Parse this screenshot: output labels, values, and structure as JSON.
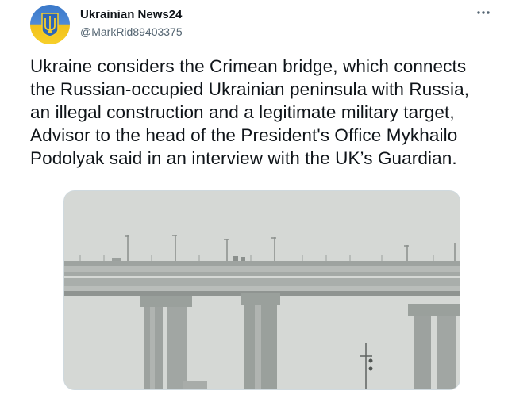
{
  "author": {
    "display_name": "Ukrainian News24",
    "handle": "@MarkRid89403375",
    "avatar_icon": "ukraine-trident-icon"
  },
  "tweet": {
    "text": "Ukraine considers the Crimean bridge, which connects\nthe Russian-occupied Ukrainian peninsula with Russia,\nan illegal construction and a legitimate military target,\nAdvisor to the head of the President's Office Mykhailo\nPodolyak said in an interview with the UK’s Guardian."
  },
  "menu": {
    "icon": "more-horizontal-icon"
  },
  "media": {
    "subject": "crimean-bridge-photo"
  },
  "colors": {
    "text": "#0f1419",
    "secondary": "#536471",
    "avatar_blue": "#3a78c9",
    "avatar_yellow": "#f2c11a"
  }
}
